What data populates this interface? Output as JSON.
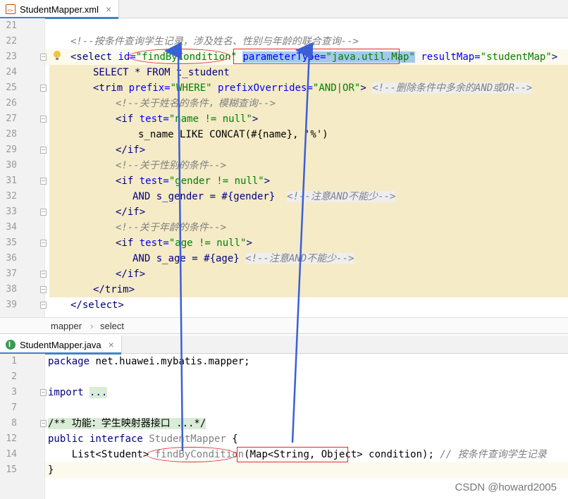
{
  "top_editor": {
    "tab": {
      "label": "StudentMapper.xml",
      "close": "×",
      "icon": "xml-file-icon"
    },
    "lines": [
      {
        "n": "21",
        "text": ""
      },
      {
        "n": "22",
        "comment": "<!--按条件查询学生记录，涉及姓名、性别与年龄的联合查询-->"
      },
      {
        "n": "23",
        "open": "<select ",
        "id_attr": "id=",
        "id_val": "\"findByCondition\"",
        "param_attr": "parameterType=",
        "param_val": "\"java.util.Map\"",
        "rm_attr": " resultMap=",
        "rm_val": "\"studentMap\"",
        "close": ">"
      },
      {
        "n": "24",
        "text": "SELECT * FROM t_student"
      },
      {
        "n": "25",
        "open": "<trim ",
        "a1": "prefix=",
        "v1": "\"WHERE\"",
        "a2": " prefixOverrides=",
        "v2": "\"AND|OR\"",
        "close": ">",
        "comment": "<!--删除条件中多余的AND或OR-->"
      },
      {
        "n": "26",
        "comment": "<!--关于姓名的条件，模糊查询-->"
      },
      {
        "n": "27",
        "open": "<if ",
        "a1": "test=",
        "v1": "\"name != null\"",
        "close": ">"
      },
      {
        "n": "28",
        "text": "s_name LIKE CONCAT(#{name}, '%')"
      },
      {
        "n": "29",
        "tag": "</if>"
      },
      {
        "n": "30",
        "comment": "<!--关于性别的条件-->"
      },
      {
        "n": "31",
        "open": "<if ",
        "a1": "test=",
        "v1": "\"gender != null\"",
        "close": ">"
      },
      {
        "n": "32",
        "text": "AND s_gender = #{gender}",
        "comment": "<!--注意AND不能少-->"
      },
      {
        "n": "33",
        "tag": "</if>"
      },
      {
        "n": "34",
        "comment": "<!--关于年龄的条件-->"
      },
      {
        "n": "35",
        "open": "<if ",
        "a1": "test=",
        "v1": "\"age != null\"",
        "close": ">"
      },
      {
        "n": "36",
        "text": "AND s_age = #{age}",
        "comment": "<!--注意AND不能少-->"
      },
      {
        "n": "37",
        "tag": "</if>"
      },
      {
        "n": "38",
        "tag": "</trim>"
      },
      {
        "n": "39",
        "tag": "</select>"
      },
      {
        "n": "",
        "text": ""
      }
    ],
    "breadcrumb": [
      "mapper",
      "select"
    ],
    "breadcrumb_sep": "›"
  },
  "bottom_editor": {
    "tab": {
      "label": "StudentMapper.java",
      "close": "×",
      "icon": "java-interface-icon"
    },
    "lines": [
      {
        "n": "1",
        "kw": "package",
        "rest": " net.huawei.mybatis.mapper;"
      },
      {
        "n": "2",
        "text": ""
      },
      {
        "n": "3",
        "kw": "import",
        "rest": " ",
        "folded": "..."
      },
      {
        "n": "7",
        "text": ""
      },
      {
        "n": "8",
        "folded_comment": "/** 功能：学生映射器接口 ...*/"
      },
      {
        "n": "12",
        "kw": "public interface",
        "gray": " StudentMapper",
        "rest": " {"
      },
      {
        "n": "14",
        "pre": "    List<Student> ",
        "method": "findByCondition",
        "param": "(Map<String, Object>",
        "rest": " condition); ",
        "comment": "// 按条件查询学生记录"
      },
      {
        "n": "15",
        "text": "}"
      }
    ]
  },
  "watermark": "CSDN @howard2005",
  "colors": {
    "arrow": "#3b5fd6",
    "annotation_red": "#e02b2b",
    "xml_tag": "#000080",
    "xml_attr": "#0000ff",
    "xml_value": "#008000",
    "comment": "#808080",
    "selection": "#a6c8ec",
    "highlight_region": "#f5ebc6"
  }
}
